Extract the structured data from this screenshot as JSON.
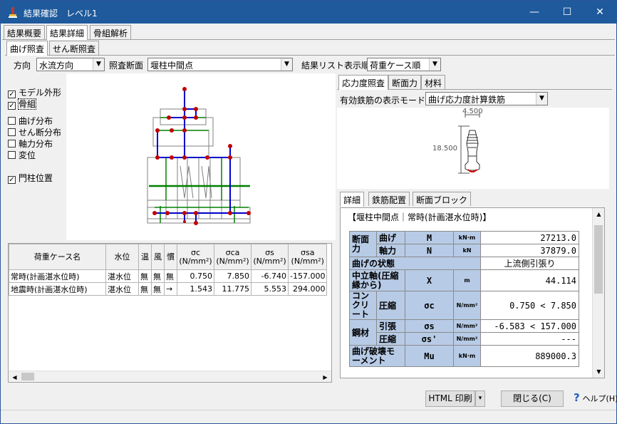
{
  "window": {
    "title": "結果確認　レベル1",
    "minimize": "—",
    "maximize": "☐",
    "close": "✕"
  },
  "main_tabs": [
    "結果概要",
    "結果詳細",
    "骨組解析"
  ],
  "sub_tabs": [
    "曲げ照査",
    "せん断照査"
  ],
  "filters": {
    "direction_label": "方向",
    "direction_value": "水流方向",
    "section_label": "照査断面",
    "section_value": "堰柱中間点",
    "order_label": "結果リスト表示順",
    "order_value": "荷重ケース順"
  },
  "checkboxes": [
    {
      "label": "モデル外形",
      "checked": true
    },
    {
      "label": "骨組",
      "checked": true
    },
    {
      "label": "曲げ分布",
      "checked": false
    },
    {
      "label": "せん断分布",
      "checked": false
    },
    {
      "label": "軸力分布",
      "checked": false
    },
    {
      "label": "変位",
      "checked": false
    },
    {
      "label": "門柱位置",
      "checked": true
    }
  ],
  "cases_table": {
    "headers": [
      "荷重ケース名",
      "水位",
      "温",
      "風",
      "慣",
      "σc\n(N/mm²)",
      "σca\n(N/mm²)",
      "σs\n(N/mm²)",
      "σsa\n(N/mm²)"
    ],
    "rows": [
      [
        "常時(計画湛水位時)",
        "湛水位",
        "無",
        "無",
        "無",
        "0.750",
        "7.850",
        "-6.740",
        "-157.000"
      ],
      [
        "地震時(計画湛水位時)",
        "湛水位",
        "無",
        "無",
        "→",
        "1.543",
        "11.775",
        "5.553",
        "294.000"
      ]
    ]
  },
  "right_tabs": [
    "応力度照査",
    "断面力",
    "材料"
  ],
  "rebar_mode": {
    "label": "有効鉄筋の表示モード",
    "value": "曲げ応力度計算鉄筋"
  },
  "section_fig": {
    "width_label": "4.500",
    "height_label": "18.500"
  },
  "detail_tabs": [
    "詳細",
    "鉄筋配置",
    "断面ブロック"
  ],
  "detail": {
    "heading": "【堰柱中間点｜常時(計画湛水位時)】",
    "rows": {
      "section_force": "断面力",
      "moment_label": "曲げ",
      "moment_sym": "M",
      "moment_unit": "kN·m",
      "moment_val": "27213.0",
      "axial_label": "軸力",
      "axial_sym": "N",
      "axial_unit": "kN",
      "axial_val": "37879.0",
      "state_label": "曲げの状態",
      "state_val": "上流側引張り",
      "neutral_label": "中立軸(圧縮縁から)",
      "neutral_sym": "X",
      "neutral_unit": "m",
      "neutral_val": "44.114",
      "concrete_label": "コンクリート",
      "concrete_sub": "圧縮",
      "concrete_sym": "σc",
      "concrete_unit": "N/mm²",
      "concrete_val": "0.750 < 7.850",
      "steel_label": "鋼材",
      "steel_tension": "引張",
      "steel_t_sym": "σs",
      "steel_t_unit": "N/mm²",
      "steel_t_val": "-6.583 < 157.000",
      "steel_comp": "圧縮",
      "steel_c_sym": "σs'",
      "steel_c_unit": "N/mm²",
      "steel_c_val": "---",
      "ultimate_label": "曲げ破壊モーメント",
      "ultimate_sym": "Mu",
      "ultimate_unit": "kN·m",
      "ultimate_val": "889000.3"
    }
  },
  "buttons": {
    "print": "HTML 印刷",
    "print_arrow": "▾",
    "close": "閉じる(C)",
    "help": "ヘルプ(H)"
  },
  "colors": {
    "titlebar": "#1e5a9c",
    "header_cell": "#b7cbe6",
    "frame_blue": "#0000cc",
    "frame_green": "#008000",
    "node_red": "#c00000"
  }
}
